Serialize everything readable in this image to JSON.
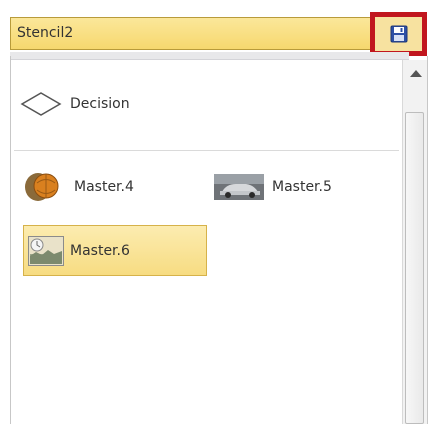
{
  "stencil": {
    "title": "Stencil2",
    "save_icon": "save-disk-icon"
  },
  "shapes": [
    {
      "label": "Decision",
      "icon": "diamond-icon"
    },
    {
      "label": "Master.4",
      "icon": "orange-balls-icon"
    },
    {
      "label": "Master.5",
      "icon": "car-photo-icon"
    },
    {
      "label": "Master.6",
      "icon": "landscape-thumbnail-icon",
      "selected": true
    }
  ],
  "colors": {
    "title_bar": "#f6d86e",
    "highlight_border": "#c1161e",
    "selected_bg": "#f7dc82"
  }
}
